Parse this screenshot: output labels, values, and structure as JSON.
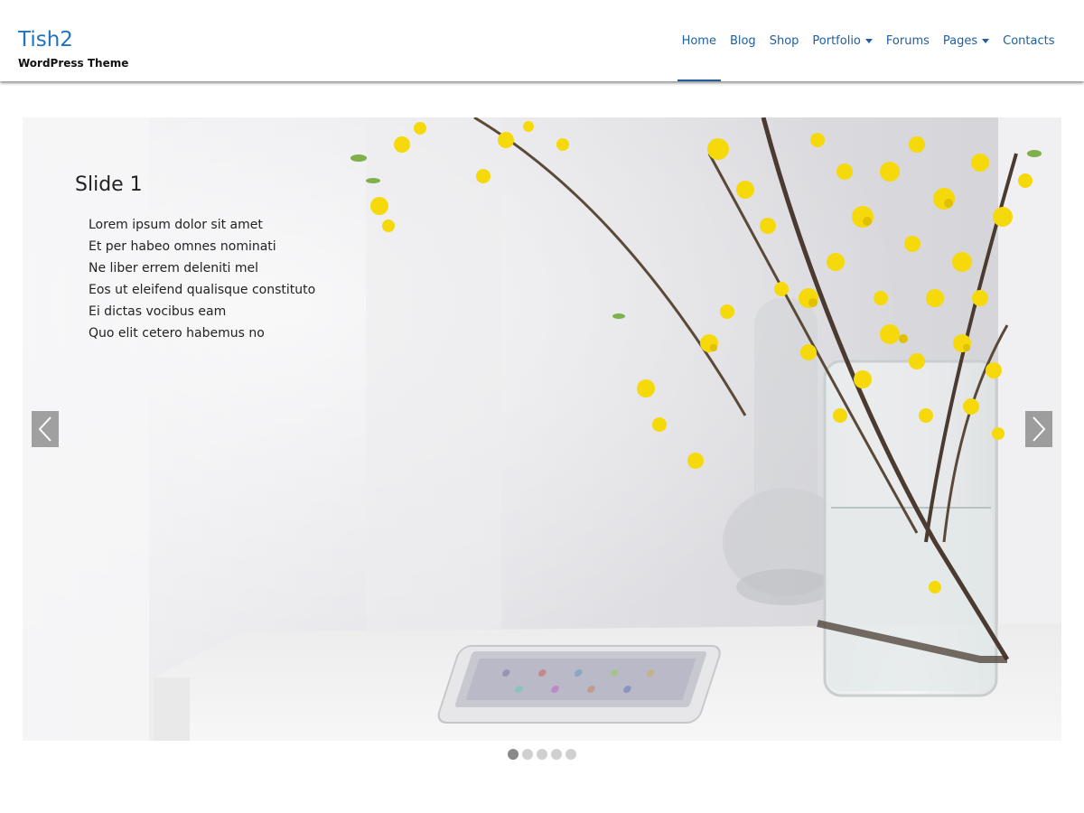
{
  "site": {
    "title": "Tish2",
    "tagline": "WordPress Theme"
  },
  "nav": {
    "items": [
      {
        "label": "Home",
        "active": true,
        "dropdown": false
      },
      {
        "label": "Blog",
        "active": false,
        "dropdown": false
      },
      {
        "label": "Shop",
        "active": false,
        "dropdown": false
      },
      {
        "label": "Portfolio",
        "active": false,
        "dropdown": true
      },
      {
        "label": "Forums",
        "active": false,
        "dropdown": false
      },
      {
        "label": "Pages",
        "active": false,
        "dropdown": true
      },
      {
        "label": "Contacts",
        "active": false,
        "dropdown": false
      }
    ]
  },
  "slider": {
    "current_slide": 1,
    "slide_count": 5,
    "caption": {
      "title": "Slide 1",
      "lines": [
        "Lorem ipsum dolor sit amet",
        "Et per habeo omnes nominati",
        "Ne liber errem deleniti mel",
        "Eos ut eleifend qualisque constituto",
        "Ei dictas vocibus eam",
        "Quo elit cetero habemus no"
      ]
    },
    "prev_icon": "chevron-left-icon",
    "next_icon": "chevron-right-icon"
  },
  "colors": {
    "accent": "#1e73be",
    "nav_text": "#1e5fa0",
    "flower": "#f5d90a",
    "dot_active": "#8a8a8a",
    "dot_inactive": "#d0d0d0"
  }
}
